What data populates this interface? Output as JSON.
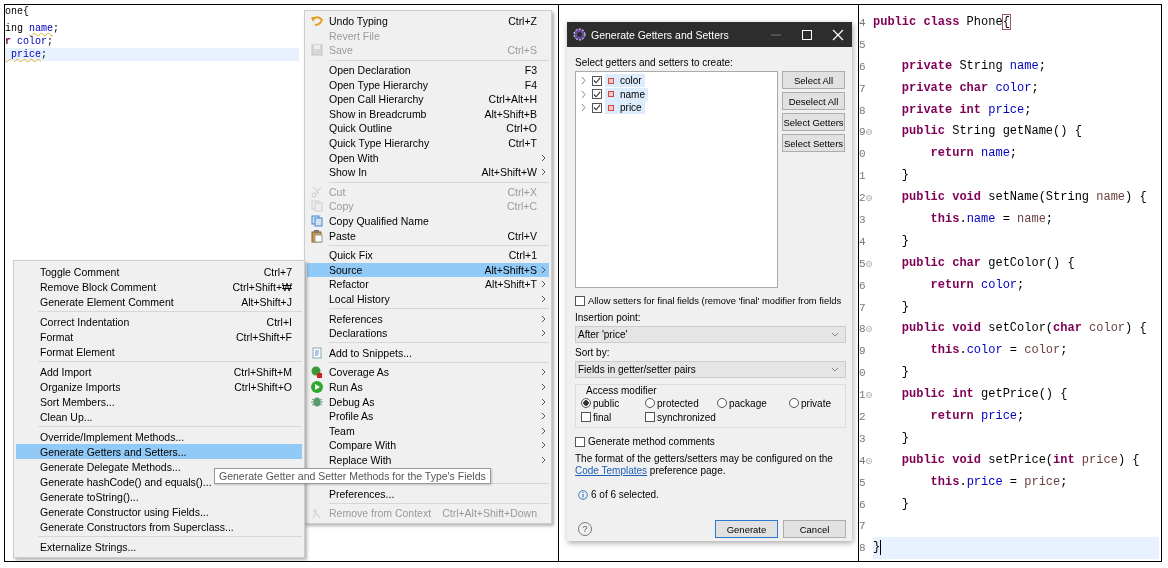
{
  "editor": {
    "lines": [
      {
        "current": false,
        "tokens": [
          {
            "text": "one{",
            "kind": "plain"
          }
        ]
      },
      {
        "current": false,
        "tokens": [
          {
            "text": "ing ",
            "kind": "plain"
          },
          {
            "text": "name",
            "kind": "warned"
          },
          {
            "text": ";",
            "kind": "plain"
          }
        ]
      },
      {
        "current": false,
        "tokens": [
          {
            "text": "r",
            "kind": "kw"
          },
          {
            "text": " color",
            "kind": "field"
          },
          {
            "text": ";",
            "kind": "plain"
          }
        ]
      },
      {
        "current": true,
        "tokens": [
          {
            "text": " price",
            "kind": "warned"
          },
          {
            "text": ";",
            "kind": "plain"
          }
        ]
      }
    ]
  },
  "context_menu": {
    "items": [
      {
        "kind": "item",
        "label": "Undo Typing",
        "shortcut": "Ctrl+Z",
        "disabled": false,
        "submenu": false,
        "selected": false
      },
      {
        "kind": "item",
        "label": "Revert File",
        "disabled": true,
        "submenu": false,
        "selected": false
      },
      {
        "kind": "item",
        "label": "Save",
        "shortcut": "Ctrl+S",
        "disabled": true,
        "submenu": false,
        "selected": false
      },
      {
        "kind": "separator"
      },
      {
        "kind": "item",
        "label": "Open Declaration",
        "shortcut": "F3",
        "disabled": false,
        "submenu": false,
        "selected": false
      },
      {
        "kind": "item",
        "label": "Open Type Hierarchy",
        "shortcut": "F4",
        "disabled": false,
        "submenu": false,
        "selected": false
      },
      {
        "kind": "item",
        "label": "Open Call Hierarchy",
        "shortcut": "Ctrl+Alt+H",
        "disabled": false,
        "submenu": false,
        "selected": false
      },
      {
        "kind": "item",
        "label": "Show in Breadcrumb",
        "shortcut": "Alt+Shift+B",
        "disabled": false,
        "submenu": false,
        "selected": false
      },
      {
        "kind": "item",
        "label": "Quick Outline",
        "shortcut": "Ctrl+O",
        "disabled": false,
        "submenu": false,
        "selected": false
      },
      {
        "kind": "item",
        "label": "Quick Type Hierarchy",
        "shortcut": "Ctrl+T",
        "disabled": false,
        "submenu": false,
        "selected": false
      },
      {
        "kind": "item",
        "label": "Open With",
        "disabled": false,
        "submenu": true,
        "selected": false
      },
      {
        "kind": "item",
        "label": "Show In",
        "shortcut": "Alt+Shift+W",
        "disabled": false,
        "submenu": true,
        "selected": false
      },
      {
        "kind": "separator"
      },
      {
        "kind": "item",
        "label": "Cut",
        "shortcut": "Ctrl+X",
        "disabled": true,
        "submenu": false,
        "selected": false
      },
      {
        "kind": "item",
        "label": "Copy",
        "shortcut": "Ctrl+C",
        "disabled": true,
        "submenu": false,
        "selected": false
      },
      {
        "kind": "item",
        "label": "Copy Qualified Name",
        "disabled": false,
        "submenu": false,
        "selected": false
      },
      {
        "kind": "item",
        "label": "Paste",
        "shortcut": "Ctrl+V",
        "disabled": false,
        "submenu": false,
        "selected": false
      },
      {
        "kind": "separator"
      },
      {
        "kind": "item",
        "label": "Quick Fix",
        "shortcut": "Ctrl+1",
        "disabled": false,
        "submenu": false,
        "selected": false
      },
      {
        "kind": "item",
        "label": "Source",
        "shortcut": "Alt+Shift+S",
        "disabled": false,
        "submenu": true,
        "selected": true
      },
      {
        "kind": "item",
        "label": "Refactor",
        "shortcut": "Alt+Shift+T",
        "disabled": false,
        "submenu": true,
        "selected": false
      },
      {
        "kind": "item",
        "label": "Local History",
        "disabled": false,
        "submenu": true,
        "selected": false
      },
      {
        "kind": "separator"
      },
      {
        "kind": "item",
        "label": "References",
        "disabled": false,
        "submenu": true,
        "selected": false
      },
      {
        "kind": "item",
        "label": "Declarations",
        "disabled": false,
        "submenu": true,
        "selected": false
      },
      {
        "kind": "separator"
      },
      {
        "kind": "item",
        "label": "Add to Snippets...",
        "disabled": false,
        "submenu": false,
        "selected": false
      },
      {
        "kind": "separator"
      },
      {
        "kind": "item",
        "label": "Coverage As",
        "disabled": false,
        "submenu": true,
        "selected": false
      },
      {
        "kind": "item",
        "label": "Run As",
        "disabled": false,
        "submenu": true,
        "selected": false
      },
      {
        "kind": "item",
        "label": "Debug As",
        "disabled": false,
        "submenu": true,
        "selected": false
      },
      {
        "kind": "item",
        "label": "Profile As",
        "disabled": false,
        "submenu": true,
        "selected": false
      },
      {
        "kind": "item",
        "label": "Team",
        "disabled": false,
        "submenu": true,
        "selected": false
      },
      {
        "kind": "item",
        "label": "Compare With",
        "disabled": false,
        "submenu": true,
        "selected": false
      },
      {
        "kind": "item",
        "label": "Replace With",
        "disabled": false,
        "submenu": true,
        "selected": false
      },
      {
        "kind": "separator"
      },
      {
        "kind": "item",
        "label": "Preferences...",
        "disabled": false,
        "submenu": false,
        "selected": false
      },
      {
        "kind": "separator"
      },
      {
        "kind": "item",
        "label": "Remove from Context",
        "shortcut": "Ctrl+Alt+Shift+Down",
        "disabled": true,
        "submenu": false,
        "selected": false
      }
    ]
  },
  "source_submenu": {
    "items": [
      {
        "kind": "item",
        "label": "Toggle Comment",
        "shortcut": "Ctrl+7",
        "selected": false
      },
      {
        "kind": "item",
        "label": "Remove Block Comment",
        "shortcut": "Ctrl+Shift+₩",
        "selected": false
      },
      {
        "kind": "item",
        "label": "Generate Element Comment",
        "shortcut": "Alt+Shift+J",
        "selected": false
      },
      {
        "kind": "separator"
      },
      {
        "kind": "item",
        "label": "Correct Indentation",
        "shortcut": "Ctrl+I",
        "selected": false
      },
      {
        "kind": "item",
        "label": "Format",
        "shortcut": "Ctrl+Shift+F",
        "selected": false
      },
      {
        "kind": "item",
        "label": "Format Element",
        "selected": false
      },
      {
        "kind": "separator"
      },
      {
        "kind": "item",
        "label": "Add Import",
        "shortcut": "Ctrl+Shift+M",
        "selected": false
      },
      {
        "kind": "item",
        "label": "Organize Imports",
        "shortcut": "Ctrl+Shift+O",
        "selected": false
      },
      {
        "kind": "item",
        "label": "Sort Members...",
        "selected": false
      },
      {
        "kind": "item",
        "label": "Clean Up...",
        "selected": false
      },
      {
        "kind": "separator"
      },
      {
        "kind": "item",
        "label": "Override/Implement Methods...",
        "selected": false
      },
      {
        "kind": "item",
        "label": "Generate Getters and Setters...",
        "selected": true
      },
      {
        "kind": "item",
        "label": "Generate Delegate Methods...",
        "selected": false
      },
      {
        "kind": "item",
        "label": "Generate hashCode() and equals()...",
        "selected": false
      },
      {
        "kind": "item",
        "label": "Generate toString()...",
        "selected": false
      },
      {
        "kind": "item",
        "label": "Generate Constructor using Fields...",
        "selected": false
      },
      {
        "kind": "item",
        "label": "Generate Constructors from Superclass...",
        "selected": false
      },
      {
        "kind": "separator"
      },
      {
        "kind": "item",
        "label": "Externalize Strings...",
        "selected": false
      }
    ]
  },
  "tooltip": {
    "text": "Generate Getter and Setter Methods for the Type's Fields"
  },
  "dialog": {
    "title": "Generate Getters and Setters",
    "prompt": "Select getters and setters to create:",
    "fields": [
      {
        "name": "color",
        "checked": true,
        "expanded": false,
        "selected": true
      },
      {
        "name": "name",
        "checked": true,
        "expanded": false,
        "selected": true
      },
      {
        "name": "price",
        "checked": true,
        "expanded": false,
        "selected": true
      }
    ],
    "side_buttons": [
      "Select All",
      "Deselect All",
      "Select Getters",
      "Select Setters"
    ],
    "allow_final": {
      "label": "Allow setters for final fields (remove 'final' modifier from fields",
      "checked": false
    },
    "insertion_point": {
      "label": "Insertion point:",
      "value": "After 'price'"
    },
    "sort_by": {
      "label": "Sort by:",
      "value": "Fields in getter/setter pairs"
    },
    "access_modifier": {
      "title": "Access modifier",
      "options": [
        {
          "label": "public",
          "selected": true
        },
        {
          "label": "protected",
          "selected": false
        },
        {
          "label": "package",
          "selected": false
        },
        {
          "label": "private",
          "selected": false
        }
      ],
      "flags": [
        {
          "label": "final",
          "checked": false
        },
        {
          "label": "synchronized",
          "checked": false
        }
      ]
    },
    "method_comments": {
      "label": "Generate method comments",
      "checked": false
    },
    "note": {
      "before": "The format of the getters/setters may be configured on the ",
      "link": "Code Templates",
      "after": " preference page."
    },
    "status": "6 of 6 selected.",
    "help": "?",
    "actions": [
      {
        "label": "Generate",
        "default": true
      },
      {
        "label": "Cancel",
        "default": false
      }
    ]
  },
  "code_editor": {
    "lines": [
      {
        "number": "4",
        "fold": false,
        "current": false,
        "tokens": [
          {
            "text": "public class",
            "kind": "kw"
          },
          {
            "text": " Phone",
            "kind": "plain"
          },
          {
            "text": "{",
            "kind": "bracket"
          }
        ]
      },
      {
        "number": "5",
        "fold": false,
        "current": false
      },
      {
        "number": "6",
        "fold": false,
        "current": false,
        "tokens": [
          {
            "text": "    private",
            "kind": "kw"
          },
          {
            "text": " String ",
            "kind": "plain"
          },
          {
            "text": "name",
            "kind": "field"
          },
          {
            "text": ";",
            "kind": "plain"
          }
        ]
      },
      {
        "number": "7",
        "fold": false,
        "current": false,
        "tokens": [
          {
            "text": "    private char",
            "kind": "kw"
          },
          {
            "text": " color",
            "kind": "field"
          },
          {
            "text": ";",
            "kind": "plain"
          }
        ]
      },
      {
        "number": "8",
        "fold": false,
        "current": false,
        "tokens": [
          {
            "text": "    private int",
            "kind": "kw"
          },
          {
            "text": " price",
            "kind": "field"
          },
          {
            "text": ";",
            "kind": "plain"
          }
        ]
      },
      {
        "number": "9",
        "fold": true,
        "current": false,
        "tokens": [
          {
            "text": "    public",
            "kind": "kw"
          },
          {
            "text": " String getName() {",
            "kind": "plain"
          }
        ]
      },
      {
        "number": "0",
        "fold": false,
        "current": false,
        "tokens": [
          {
            "text": "        return",
            "kind": "kw"
          },
          {
            "text": " name",
            "kind": "field"
          },
          {
            "text": ";",
            "kind": "plain"
          }
        ]
      },
      {
        "number": "1",
        "fold": false,
        "current": false,
        "tokens": [
          {
            "text": "    }",
            "kind": "plain"
          }
        ]
      },
      {
        "number": "2",
        "fold": true,
        "current": false,
        "tokens": [
          {
            "text": "    public void",
            "kind": "kw"
          },
          {
            "text": " setName(String ",
            "kind": "plain"
          },
          {
            "text": "name",
            "kind": "param"
          },
          {
            "text": ") {",
            "kind": "plain"
          }
        ]
      },
      {
        "number": "3",
        "fold": false,
        "current": false,
        "tokens": [
          {
            "text": "        this",
            "kind": "kw"
          },
          {
            "text": ".",
            "kind": "plain"
          },
          {
            "text": "name",
            "kind": "field"
          },
          {
            "text": " = ",
            "kind": "plain"
          },
          {
            "text": "name",
            "kind": "param"
          },
          {
            "text": ";",
            "kind": "plain"
          }
        ]
      },
      {
        "number": "4",
        "fold": false,
        "current": false,
        "tokens": [
          {
            "text": "    }",
            "kind": "plain"
          }
        ]
      },
      {
        "number": "5",
        "fold": true,
        "current": false,
        "tokens": [
          {
            "text": "    public char",
            "kind": "kw"
          },
          {
            "text": " getColor() {",
            "kind": "plain"
          }
        ]
      },
      {
        "number": "6",
        "fold": false,
        "current": false,
        "tokens": [
          {
            "text": "        return",
            "kind": "kw"
          },
          {
            "text": " color",
            "kind": "field"
          },
          {
            "text": ";",
            "kind": "plain"
          }
        ]
      },
      {
        "number": "7",
        "fold": false,
        "current": false,
        "tokens": [
          {
            "text": "    }",
            "kind": "plain"
          }
        ]
      },
      {
        "number": "8",
        "fold": true,
        "current": false,
        "tokens": [
          {
            "text": "    public void",
            "kind": "kw"
          },
          {
            "text": " setColor(",
            "kind": "plain"
          },
          {
            "text": "char",
            "kind": "kw"
          },
          {
            "text": " color",
            "kind": "param"
          },
          {
            "text": ") {",
            "kind": "plain"
          }
        ]
      },
      {
        "number": "9",
        "fold": false,
        "current": false,
        "tokens": [
          {
            "text": "        this",
            "kind": "kw"
          },
          {
            "text": ".",
            "kind": "plain"
          },
          {
            "text": "color",
            "kind": "field"
          },
          {
            "text": " = ",
            "kind": "plain"
          },
          {
            "text": "color",
            "kind": "param"
          },
          {
            "text": ";",
            "kind": "plain"
          }
        ]
      },
      {
        "number": "0",
        "fold": false,
        "current": false,
        "tokens": [
          {
            "text": "    }",
            "kind": "plain"
          }
        ]
      },
      {
        "number": "1",
        "fold": true,
        "current": false,
        "tokens": [
          {
            "text": "    public int",
            "kind": "kw"
          },
          {
            "text": " getPrice() {",
            "kind": "plain"
          }
        ]
      },
      {
        "number": "2",
        "fold": false,
        "current": false,
        "tokens": [
          {
            "text": "        return",
            "kind": "kw"
          },
          {
            "text": " price",
            "kind": "field"
          },
          {
            "text": ";",
            "kind": "plain"
          }
        ]
      },
      {
        "number": "3",
        "fold": false,
        "current": false,
        "tokens": [
          {
            "text": "    }",
            "kind": "plain"
          }
        ]
      },
      {
        "number": "4",
        "fold": true,
        "current": false,
        "tokens": [
          {
            "text": "    public void",
            "kind": "kw"
          },
          {
            "text": " setPrice(",
            "kind": "plain"
          },
          {
            "text": "int",
            "kind": "kw"
          },
          {
            "text": " price",
            "kind": "param"
          },
          {
            "text": ") {",
            "kind": "plain"
          }
        ]
      },
      {
        "number": "5",
        "fold": false,
        "current": false,
        "tokens": [
          {
            "text": "        this",
            "kind": "kw"
          },
          {
            "text": ".",
            "kind": "plain"
          },
          {
            "text": "price",
            "kind": "field"
          },
          {
            "text": " = ",
            "kind": "plain"
          },
          {
            "text": "price",
            "kind": "param"
          },
          {
            "text": ";",
            "kind": "plain"
          }
        ]
      },
      {
        "number": "6",
        "fold": false,
        "current": false,
        "tokens": [
          {
            "text": "    }",
            "kind": "plain"
          }
        ]
      },
      {
        "number": "7",
        "fold": false,
        "current": false
      },
      {
        "number": "8",
        "fold": false,
        "current": true,
        "cursor": true,
        "tokens": [
          {
            "text": "}",
            "kind": "plain"
          }
        ]
      }
    ]
  }
}
